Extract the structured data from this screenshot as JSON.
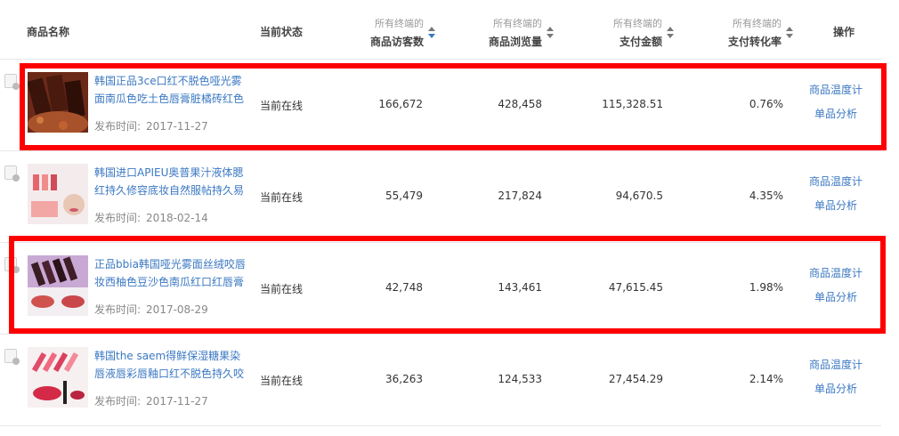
{
  "header": {
    "product_name": "商品名称",
    "status": "当前状态",
    "visitors_sub": "所有终端的",
    "visitors": "商品访客数",
    "views_sub": "所有终端的",
    "views": "商品浏览量",
    "pay_sub": "所有终端的",
    "pay": "支付金额",
    "conv_sub": "所有终端的",
    "conv": "支付转化率",
    "ops": "操作"
  },
  "date_label": "发布时间:",
  "rows": [
    {
      "title": "韩国正品3ce口红不脱色哑光雾面南瓜色吃土色唇膏脏橘砖红色",
      "date": "2017-11-27",
      "status": "当前在线",
      "visitors": "166,672",
      "views": "428,458",
      "pay": "115,328.51",
      "conv": "0.76%",
      "op1": "商品温度计",
      "op2": "单品分析"
    },
    {
      "title": "韩国进口APIEU奥普果汁液体腮红持久修容底妆自然服帖持久易",
      "date": "2018-02-14",
      "status": "当前在线",
      "visitors": "55,479",
      "views": "217,824",
      "pay": "94,670.5",
      "conv": "4.35%",
      "op1": "商品温度计",
      "op2": "单品分析"
    },
    {
      "title": "正品bbia韩国哑光雾面丝绒咬唇妆西柚色豆沙色南瓜红口红唇膏",
      "date": "2017-08-29",
      "status": "当前在线",
      "visitors": "42,748",
      "views": "143,461",
      "pay": "47,615.45",
      "conv": "1.98%",
      "op1": "商品温度计",
      "op2": "单品分析"
    },
    {
      "title": "韩国the saem得鲜保湿糖果染唇液唇彩唇釉口红不脱色持久咬唇",
      "date": "2017-11-27",
      "status": "当前在线",
      "visitors": "36,263",
      "views": "124,533",
      "pay": "27,454.29",
      "conv": "2.14%",
      "op1": "商品温度计",
      "op2": "单品分析"
    }
  ],
  "highlight_color": "#ff0000",
  "link_color": "#3b78c2"
}
